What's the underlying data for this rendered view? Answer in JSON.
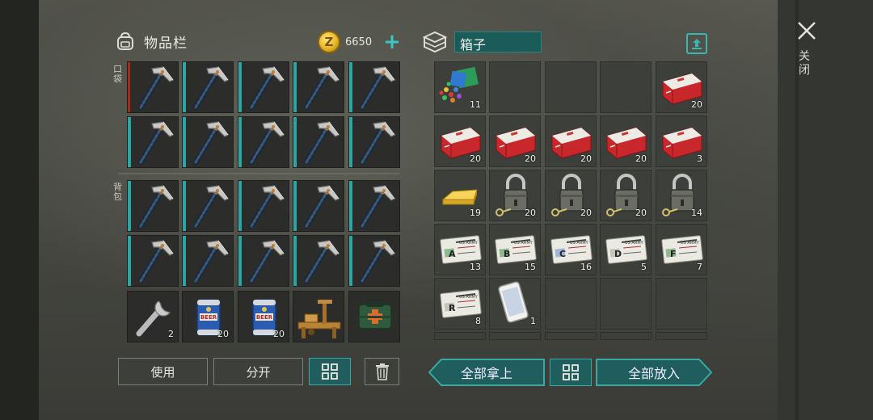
{
  "inventory": {
    "title": "物品栏",
    "coins": "6650",
    "pocket_label": "口袋",
    "backpack_label": "背包",
    "tool_counts": [
      "2",
      "20",
      "20",
      "",
      ""
    ]
  },
  "container": {
    "name": "箱子",
    "rows": [
      [
        {
          "item": "gems",
          "count": "11"
        },
        {
          "item": "",
          "count": ""
        },
        {
          "item": "",
          "count": ""
        },
        {
          "item": "",
          "count": ""
        },
        {
          "item": "meds",
          "count": "20"
        }
      ],
      [
        {
          "item": "meds",
          "count": "20"
        },
        {
          "item": "meds",
          "count": "20"
        },
        {
          "item": "meds",
          "count": "20"
        },
        {
          "item": "meds",
          "count": "20"
        },
        {
          "item": "meds",
          "count": "3"
        }
      ],
      [
        {
          "item": "gold",
          "count": "19"
        },
        {
          "item": "lock",
          "count": "20"
        },
        {
          "item": "lock",
          "count": "20"
        },
        {
          "item": "lock",
          "count": "20"
        },
        {
          "item": "lock",
          "count": "14"
        }
      ],
      [
        {
          "item": "card",
          "letter": "A",
          "count": "13"
        },
        {
          "item": "card",
          "letter": "B",
          "count": "15"
        },
        {
          "item": "card",
          "letter": "C",
          "count": "16"
        },
        {
          "item": "card",
          "letter": "D",
          "count": "5"
        },
        {
          "item": "card",
          "letter": "F",
          "count": "7"
        }
      ],
      [
        {
          "item": "card",
          "letter": "R",
          "count": "8"
        },
        {
          "item": "phone",
          "count": "1"
        },
        {
          "item": "",
          "count": ""
        },
        {
          "item": "",
          "count": ""
        },
        {
          "item": "",
          "count": ""
        }
      ]
    ]
  },
  "buttons": {
    "use": "使用",
    "split": "分开",
    "take_all": "全部拿上",
    "put_all": "全部放入",
    "close": "关闭"
  },
  "colors": {
    "accent": "#2aa6a4",
    "button_teal": "#1f5e5c"
  }
}
